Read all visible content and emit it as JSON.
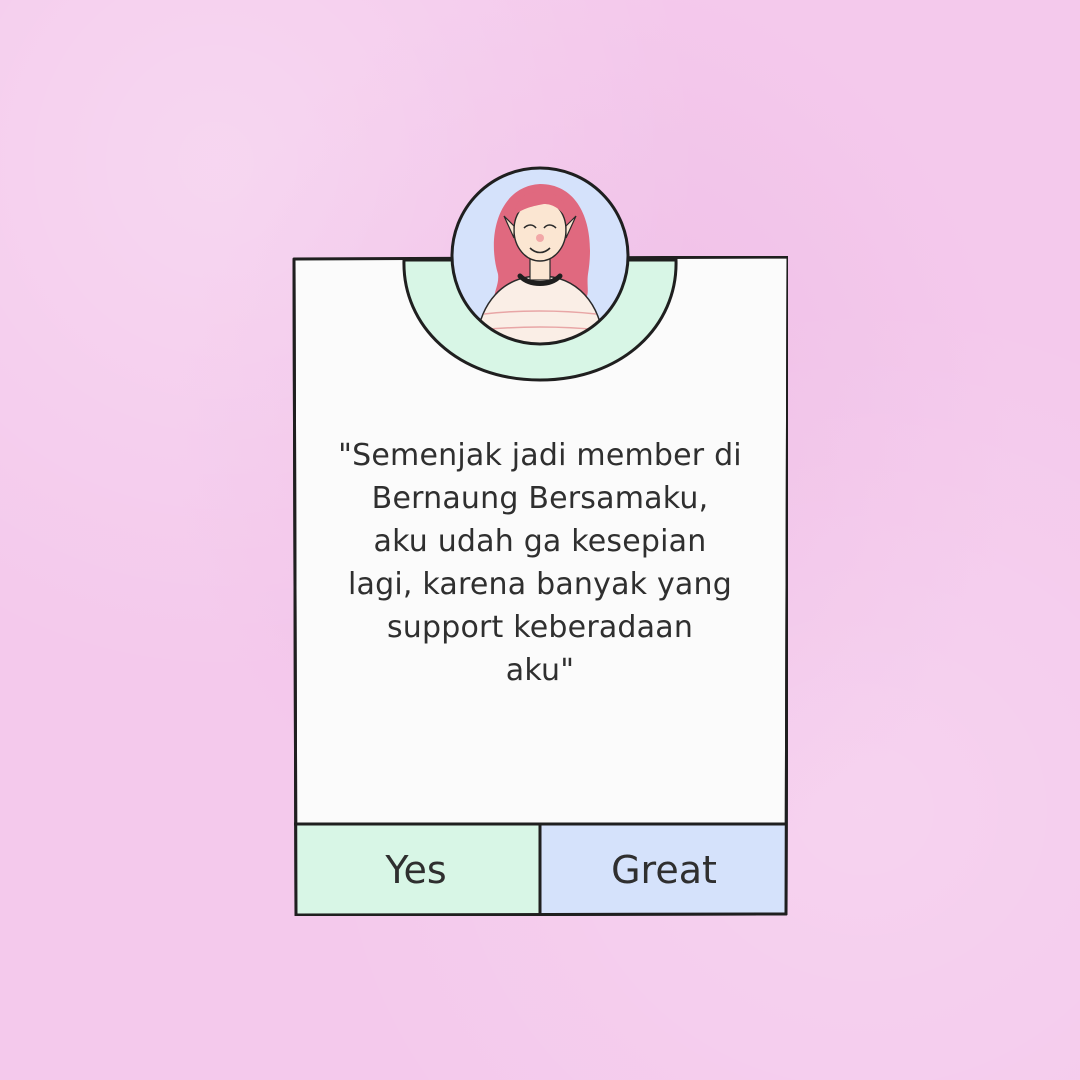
{
  "testimonial": {
    "quote": "\"Semenjak jadi member di\nBernaung Bersamaku,\naku udah ga kesepian\nlagi, karena banyak yang\nsupport keberadaan\naku\""
  },
  "buttons": {
    "yes_label": "Yes",
    "great_label": "Great"
  },
  "avatar": {
    "icon": "woman-avatar-icon"
  },
  "colors": {
    "background": "#f4c9ec",
    "card": "#fbfbfb",
    "mint": "#d8f6e6",
    "blue": "#d5e2fb",
    "outline": "#1f1f1f",
    "hair": "#e0697f"
  }
}
